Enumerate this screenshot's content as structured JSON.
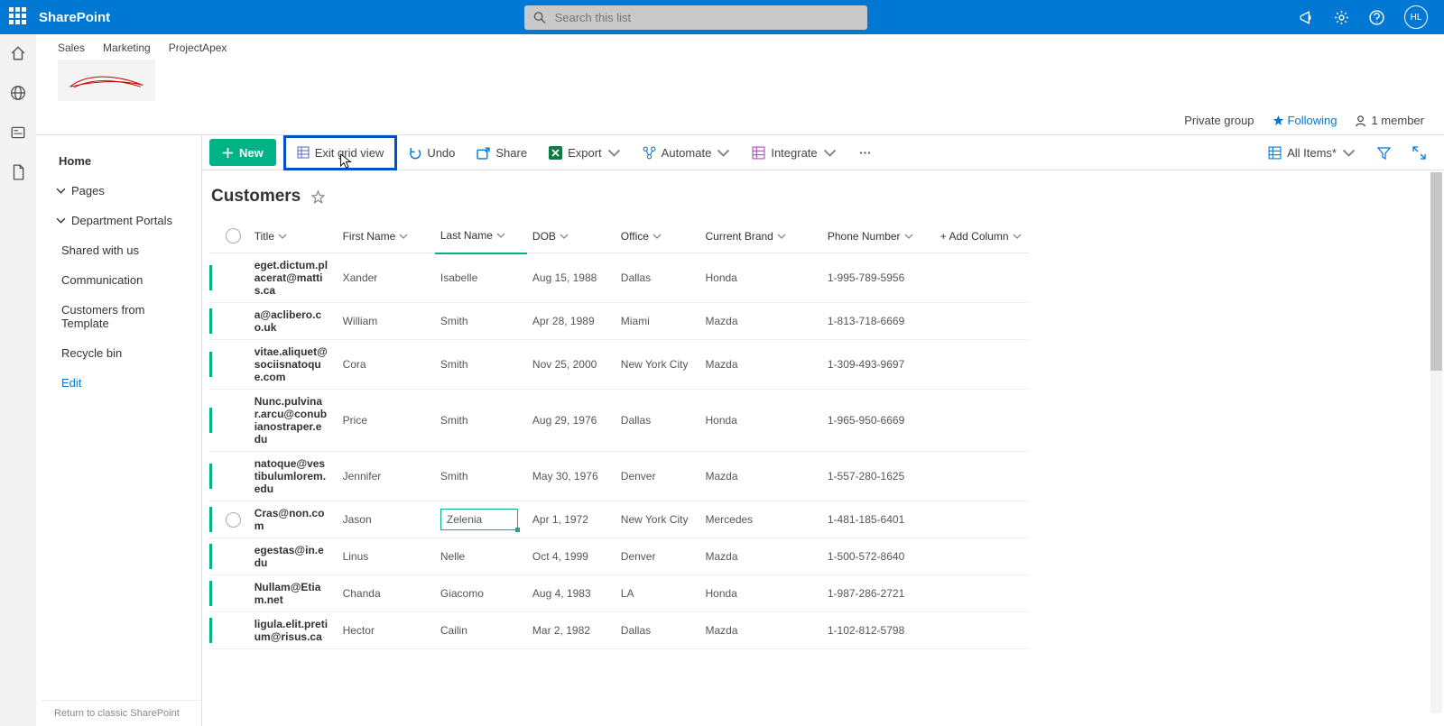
{
  "suite": {
    "app": "SharePoint",
    "search_placeholder": "Search this list",
    "avatar": "HL"
  },
  "nav": [
    "Sales",
    "Marketing",
    "ProjectApex"
  ],
  "header": {
    "private": "Private group",
    "following": "Following",
    "members": "1 member"
  },
  "ql": {
    "home": "Home",
    "pages": "Pages",
    "dept": "Department Portals",
    "shared": "Shared with us",
    "comm": "Communication",
    "cust": "Customers from Template",
    "recycle": "Recycle bin",
    "edit": "Edit",
    "classic": "Return to classic SharePoint"
  },
  "cmd": {
    "new": "New",
    "exit": "Exit grid view",
    "undo": "Undo",
    "share": "Share",
    "export": "Export",
    "automate": "Automate",
    "integrate": "Integrate",
    "allitems": "All Items*"
  },
  "list": {
    "title": "Customers"
  },
  "cols": {
    "title": "Title",
    "first": "First Name",
    "last": "Last Name",
    "dob": "DOB",
    "office": "Office",
    "brand": "Current Brand",
    "phone": "Phone Number",
    "add": "+ Add Column"
  },
  "rows": [
    {
      "title": "eget.dictum.placerat@mattis.ca",
      "first": "Xander",
      "last": "Isabelle",
      "dob": "Aug 15, 1988",
      "office": "Dallas",
      "brand": "Honda",
      "phone": "1-995-789-5956"
    },
    {
      "title": "a@aclibero.co.uk",
      "first": "William",
      "last": "Smith",
      "dob": "Apr 28, 1989",
      "office": "Miami",
      "brand": "Mazda",
      "phone": "1-813-718-6669"
    },
    {
      "title": "vitae.aliquet@sociisnatoque.com",
      "first": "Cora",
      "last": "Smith",
      "dob": "Nov 25, 2000",
      "office": "New York City",
      "brand": "Mazda",
      "phone": "1-309-493-9697"
    },
    {
      "title": "Nunc.pulvinar.arcu@conubianostraper.edu",
      "first": "Price",
      "last": "Smith",
      "dob": "Aug 29, 1976",
      "office": "Dallas",
      "brand": "Honda",
      "phone": "1-965-950-6669"
    },
    {
      "title": "natoque@vestibulumlorem.edu",
      "first": "Jennifer",
      "last": "Smith",
      "dob": "May 30, 1976",
      "office": "Denver",
      "brand": "Mazda",
      "phone": "1-557-280-1625"
    },
    {
      "title": "Cras@non.com",
      "first": "Jason",
      "last": "Zelenia",
      "dob": "Apr 1, 1972",
      "office": "New York City",
      "brand": "Mercedes",
      "phone": "1-481-185-6401",
      "selected": true
    },
    {
      "title": "egestas@in.edu",
      "first": "Linus",
      "last": "Nelle",
      "dob": "Oct 4, 1999",
      "office": "Denver",
      "brand": "Mazda",
      "phone": "1-500-572-8640"
    },
    {
      "title": "Nullam@Etiam.net",
      "first": "Chanda",
      "last": "Giacomo",
      "dob": "Aug 4, 1983",
      "office": "LA",
      "brand": "Honda",
      "phone": "1-987-286-2721"
    },
    {
      "title": "ligula.elit.pretium@risus.ca",
      "first": "Hector",
      "last": "Cailin",
      "dob": "Mar 2, 1982",
      "office": "Dallas",
      "brand": "Mazda",
      "phone": "1-102-812-5798"
    }
  ]
}
